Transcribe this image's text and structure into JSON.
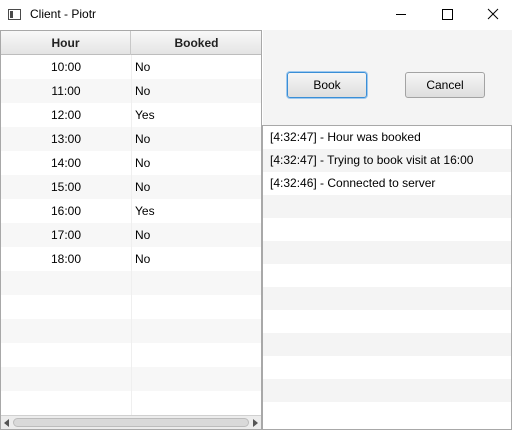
{
  "window": {
    "title": "Client - Piotr",
    "controls": {
      "minimize": "minimize-icon",
      "maximize": "maximize-icon",
      "close": "close-icon"
    }
  },
  "table": {
    "columns": [
      "Hour",
      "Booked"
    ],
    "rows": [
      {
        "hour": "10:00",
        "booked": "No"
      },
      {
        "hour": "11:00",
        "booked": "No"
      },
      {
        "hour": "12:00",
        "booked": "Yes"
      },
      {
        "hour": "13:00",
        "booked": "No"
      },
      {
        "hour": "14:00",
        "booked": "No"
      },
      {
        "hour": "15:00",
        "booked": "No"
      },
      {
        "hour": "16:00",
        "booked": "Yes"
      },
      {
        "hour": "17:00",
        "booked": "No"
      },
      {
        "hour": "18:00",
        "booked": "No"
      }
    ],
    "empty_rows": 6
  },
  "actions": {
    "book_label": "Book",
    "cancel_label": "Cancel"
  },
  "log": {
    "entries": [
      "[4:32:47] - Hour was booked",
      "[4:32:47] - Trying to book visit at 16:00",
      "[4:32:46] - Connected to server"
    ],
    "empty_rows": 10
  },
  "colors": {
    "focus_accent": "#3a8ed6",
    "row_stripe": "#f7f7f7",
    "header_bg": "#e4e4e4"
  }
}
